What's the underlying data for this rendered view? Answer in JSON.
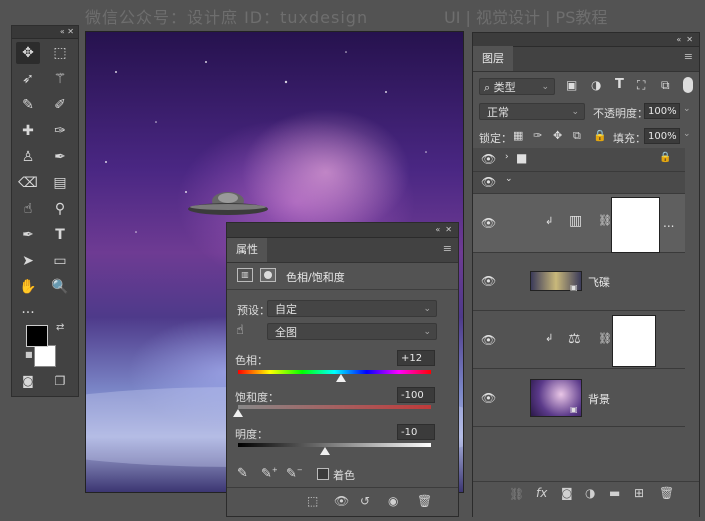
{
  "watermark": {
    "left": "微信公众号：设计庶  ID：tuxdesign",
    "right": "UI | 视觉设计 | PS教程"
  },
  "tools": {
    "collapse": "«",
    "close": "✕",
    "items": [
      "move",
      "marquee",
      "lasso",
      "magic-wand",
      "eyedropper",
      "brush-heal",
      "bandaid",
      "brush",
      "stamp",
      "history-brush",
      "eraser",
      "gradient",
      "smudge",
      "dodge",
      "pen",
      "text",
      "path-select",
      "rectangle",
      "hand",
      "zoom",
      "more"
    ]
  },
  "properties": {
    "panel_title": "属性",
    "adjustment_name": "色相/饱和度",
    "preset_label": "预设：",
    "preset_value": "自定",
    "channel_value": "全图",
    "hue_label": "色相：",
    "hue_value": "+12",
    "saturation_label": "饱和度：",
    "saturation_value": "-100",
    "lightness_label": "明度：",
    "lightness_value": "-10",
    "colorize_label": "着色",
    "colorize_checked": false,
    "hue_level": 0.533,
    "saturation_level": 0.0,
    "lightness_level": 0.45
  },
  "layers": {
    "panel_title": "图层",
    "filter_kind": "类型",
    "blend_mode": "正常",
    "opacity_label": "不透明度：",
    "opacity_value": "100%",
    "lock_label": "锁定：",
    "fill_label": "填充：",
    "fill_value": "100%",
    "items": [
      {
        "name": "",
        "type": "group-collapsed"
      },
      {
        "name": "",
        "type": "group-expanded"
      },
      {
        "name": "",
        "type": "hue-sat-adjustment"
      },
      {
        "name": "飞碟",
        "type": "smart-object"
      },
      {
        "name": "",
        "type": "balance-adjustment"
      },
      {
        "name": "背景",
        "type": "smart-object"
      }
    ],
    "more": "..."
  },
  "colors": {
    "panel": "#535353",
    "dark": "#424242",
    "accent_select": "#5f5f5f"
  }
}
